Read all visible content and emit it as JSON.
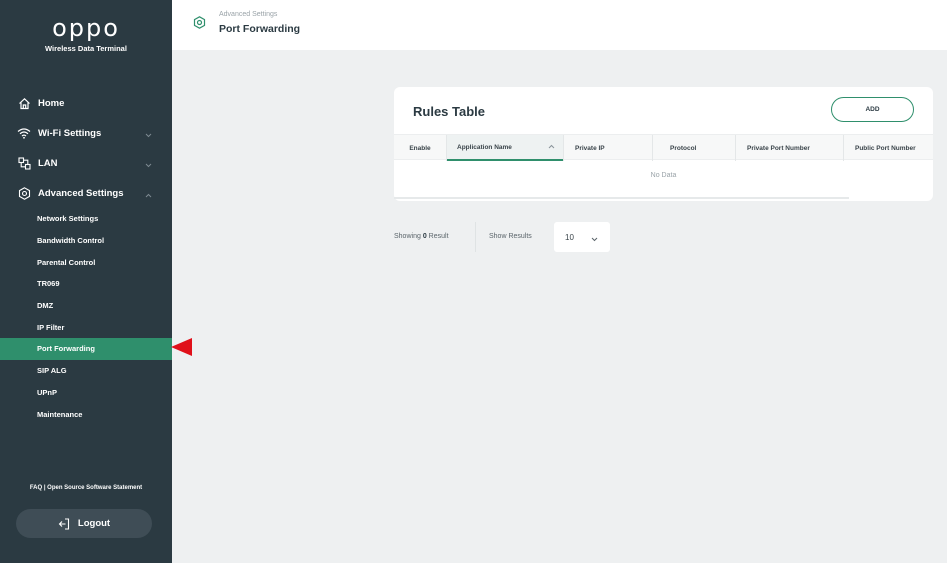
{
  "brand": {
    "logo": "oppo",
    "subtitle": "Wireless Data Terminal"
  },
  "header": {
    "breadcrumb": "Advanced Settings",
    "title": "Port Forwarding",
    "icon": "settings-ring-icon"
  },
  "nav": {
    "items": [
      {
        "label": "Home",
        "icon": "home-icon"
      },
      {
        "label": "Wi-Fi Settings",
        "icon": "wifi-icon"
      },
      {
        "label": "LAN",
        "icon": "lan-icon"
      },
      {
        "label": "Advanced Settings",
        "icon": "settings-ring-icon"
      }
    ],
    "sub_items": [
      "Network Settings",
      "Bandwidth Control",
      "Parental Control",
      "TR069",
      "DMZ",
      "IP Filter",
      "Port Forwarding",
      "SIP ALG",
      "UPnP",
      "Maintenance"
    ],
    "active_sub_item": "Port Forwarding"
  },
  "footer": {
    "links": "FAQ | Open Source Software Statement",
    "logout_label": "Logout"
  },
  "rules": {
    "title": "Rules Table",
    "add_label": "ADD",
    "columns": [
      "Enable",
      "Application Name",
      "Private IP",
      "Protocol",
      "Private Port Number",
      "Public Port Number"
    ],
    "empty_text": "No Data"
  },
  "pagination": {
    "showing_prefix": "Showing",
    "showing_count": "0",
    "showing_suffix": "Result",
    "show_results_label": "Show Results",
    "page_size": "10"
  },
  "colors": {
    "sidebar": "#2b3a42",
    "accent": "#2f8f6c",
    "pointer": "#e0101a"
  }
}
